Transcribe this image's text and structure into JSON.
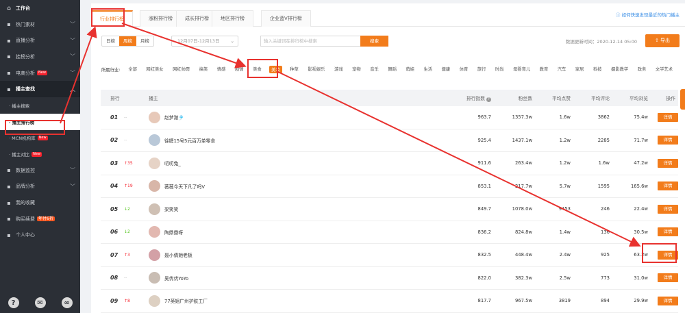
{
  "sidebar": {
    "workbench": "工作台",
    "items": [
      {
        "label": "热门素材",
        "icon": "fire-icon"
      },
      {
        "label": "直播分析",
        "icon": "live-icon"
      },
      {
        "label": "挂榜分析",
        "icon": "chart-icon"
      },
      {
        "label": "电商分析",
        "icon": "shop-icon",
        "badge": "New"
      },
      {
        "label": "播主查找",
        "icon": "search-icon"
      }
    ],
    "sub_items": [
      {
        "label": "· 播主搜索"
      },
      {
        "label": "· 播主排行榜"
      },
      {
        "label": "· MCN机构库",
        "badge": "New"
      },
      {
        "label": "· 播主对比",
        "badge": "New"
      }
    ],
    "more_items": [
      {
        "label": "数据监控",
        "icon": "monitor-icon"
      },
      {
        "label": "品牌分析",
        "icon": "brand-icon"
      },
      {
        "label": "我的收藏",
        "icon": "star-icon"
      },
      {
        "label": "购买续费",
        "icon": "cart-icon",
        "badge": "年付6折"
      },
      {
        "label": "个人中心",
        "icon": "user-icon"
      }
    ],
    "bottom_icons": [
      "help-icon",
      "wechat-icon",
      "link-icon"
    ]
  },
  "tabs": [
    "行业排行榜",
    "涨粉排行榜",
    "成长排行榜",
    "地区排行榜",
    "企业蓝V排行榜"
  ],
  "help_link": "如何快速发现最近的热门播主",
  "period": [
    "日榜",
    "周榜",
    "月榜"
  ],
  "date_range": "12月07日-12月13日",
  "search": {
    "placeholder": "输入关键词在排行榜中搜索",
    "button": "搜索"
  },
  "updated": "数据更新时间：2020-12-14 05:00",
  "export": "导出",
  "categories_label": "所属行业:",
  "categories": [
    "全部",
    "网红美女",
    "网红帅哥",
    "搞笑",
    "情感",
    "剧情",
    "美食",
    "美妆",
    "种草",
    "影视娱乐",
    "游戏",
    "宠物",
    "音乐",
    "舞蹈",
    "萌娃",
    "生活",
    "健康",
    "体育",
    "旅行",
    "时尚",
    "母婴育儿",
    "教育",
    "汽车",
    "家居",
    "科技",
    "摄影教学",
    "政务",
    "文学艺术"
  ],
  "table": {
    "headers": {
      "rank": "排行",
      "name": "播主",
      "index": "排行指数",
      "fans": "粉丝数",
      "like": "平均点赞",
      "comment": "平均评论",
      "view": "平均浏览",
      "op": "操作"
    },
    "rows": [
      {
        "rank": "01",
        "chg": "--",
        "dir": "flat",
        "name": "赵梦澈🎐",
        "index": "963.7",
        "fans": "1357.3w",
        "like": "1.6w",
        "comment": "3862",
        "view": "75.4w"
      },
      {
        "rank": "02",
        "chg": "--",
        "dir": "flat",
        "name": "徐婕15号5元百万单零食",
        "index": "925.4",
        "fans": "1437.1w",
        "like": "1.2w",
        "comment": "2285",
        "view": "71.7w"
      },
      {
        "rank": "03",
        "chg": "↑35",
        "dir": "up",
        "name": "叨叨兔_",
        "index": "911.6",
        "fans": "263.4w",
        "like": "1.2w",
        "comment": "1.6w",
        "view": "47.2w"
      },
      {
        "rank": "04",
        "chg": "↑19",
        "dir": "up",
        "name": "薇薇今天下凡了吗V",
        "index": "853.1",
        "fans": "217.7w",
        "like": "5.7w",
        "comment": "1595",
        "view": "165.6w"
      },
      {
        "rank": "05",
        "chg": "↓2",
        "dir": "down",
        "name": "梁笑笑",
        "index": "849.7",
        "fans": "1078.0w",
        "like": "9453",
        "comment": "246",
        "view": "22.4w"
      },
      {
        "rank": "06",
        "chg": "↓2",
        "dir": "down",
        "name": "陶鼎鼎呀",
        "index": "836.2",
        "fans": "824.8w",
        "like": "1.4w",
        "comment": "136",
        "view": "30.5w"
      },
      {
        "rank": "07",
        "chg": "↑3",
        "dir": "up",
        "name": "聂小倩她老板",
        "index": "832.5",
        "fans": "448.4w",
        "like": "2.4w",
        "comment": "925",
        "view": "63.2w"
      },
      {
        "rank": "08",
        "chg": "--",
        "dir": "flat",
        "name": "吴优优YoYo",
        "index": "822.0",
        "fans": "382.3w",
        "like": "2.5w",
        "comment": "773",
        "view": "31.0w"
      },
      {
        "rank": "09",
        "chg": "↑8",
        "dir": "up",
        "name": "77英姐广州护肤工厂",
        "index": "817.7",
        "fans": "967.5w",
        "like": "3819",
        "comment": "894",
        "view": "29.9w"
      }
    ],
    "detail_label": "详情"
  },
  "colors": {
    "accent": "#f27c1b",
    "annotation": "#e8322f"
  }
}
